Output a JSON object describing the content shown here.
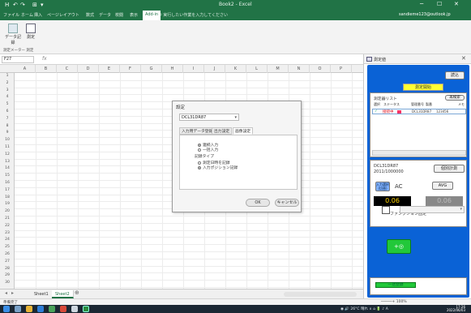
{
  "window": {
    "title": "Book2 - Excel",
    "quick_access": [
      "H",
      "↶",
      "↷",
      "⊞",
      "▾"
    ],
    "controls": [
      "─",
      "☐",
      "✕"
    ]
  },
  "ribbon": {
    "tabs": [
      "ファイル",
      "ホーム",
      "挿入",
      "ページレイアウト",
      "数式",
      "データ",
      "校閲",
      "表示",
      "Add-in"
    ],
    "active_tab_index": 8,
    "tell_me": "♀ 実行したい作業を入力してください",
    "account": "sandieme123@outlook.jp",
    "share": "♂ 共有",
    "buttons": [
      {
        "label": "データ記録",
        "icon": "data-record-icon"
      },
      {
        "label": "測定",
        "icon": "measure-icon"
      }
    ],
    "group_label": "測定メーター 測定"
  },
  "formula_bar": {
    "name_box": "F27",
    "fx": "fx"
  },
  "grid": {
    "columns": [
      "A",
      "B",
      "C",
      "D",
      "E",
      "F",
      "G",
      "H",
      "I",
      "J",
      "K",
      "L",
      "M",
      "N",
      "O",
      "P"
    ],
    "rows": [
      "1",
      "2",
      "3",
      "4",
      "5",
      "6",
      "7",
      "8",
      "9",
      "10",
      "11",
      "12",
      "13",
      "14",
      "15",
      "16",
      "17",
      "18",
      "19",
      "20",
      "21",
      "22",
      "23",
      "24",
      "25",
      "26",
      "27",
      "28",
      "29",
      "30"
    ]
  },
  "sheets": {
    "tabs": [
      "Sheet1",
      "Sheet2"
    ],
    "active_index": 1,
    "add": "⊕"
  },
  "status_bar": {
    "left": "準備完了",
    "zoom": "─────+ 100%"
  },
  "taskbar": {
    "tray": "◉ 🔊 26°C 晴れ ∧ ⌂ 🔋 ♪ A",
    "time": "17:26",
    "date": "2022/06/03"
  },
  "dialog": {
    "title": "設定",
    "device_value": "DCL31DR87",
    "tabs": [
      "入力用データ登録",
      "出力設定",
      "画像設定"
    ],
    "active_tab_index": 2,
    "option_group1": [
      "連続入力",
      "一括入力"
    ],
    "option_group1_selected": 0,
    "section_label": "記録タイプ",
    "option_group2": [
      "測定日時を記録",
      "入力ポジション記録"
    ],
    "option_group2_selected": 1,
    "ok": "OK",
    "cancel": "キャンセル"
  },
  "pane": {
    "title": "測定値",
    "close": "✕",
    "top_button": "読込",
    "yellow_button": "測定開始",
    "device_list": {
      "header": "測定器リスト",
      "refresh": "再検索",
      "columns": [
        "選択",
        "ステータス",
        "管理番号",
        "製番",
        "メモ"
      ],
      "row": {
        "checked": "✓",
        "status": "接続中",
        "id": "DCL31DR87",
        "serial": "123456"
      }
    },
    "measure": {
      "device": "DCL31DR87",
      "address": "2011/1000000",
      "reading_button": "個別計測",
      "mode_button": "入力選択\n(切替)",
      "mode_text": "AC",
      "avg_label": "AVG",
      "value1": "0.06",
      "value2": "0.06",
      "function_label": "ファンクション固定"
    },
    "green_button": "+◎",
    "bottom_button": "一括登録"
  }
}
